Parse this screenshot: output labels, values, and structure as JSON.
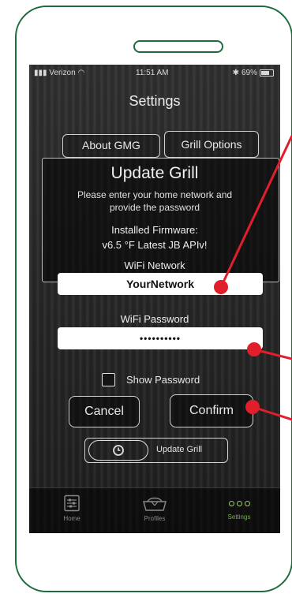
{
  "statusbar": {
    "carrier": "Verizon",
    "time": "11:51 AM",
    "battery": "69%"
  },
  "screen_title": "Settings",
  "tabs": {
    "about": "About GMG",
    "grill_options": "Grill Options"
  },
  "modal": {
    "title": "Update Grill",
    "instructions_line1": "Please enter your home network and",
    "instructions_line2": "provide the password",
    "firmware_label": "Installed Firmware:",
    "firmware_value": "v6.5 °F Latest JB APIv!",
    "network_label": "WiFi Network",
    "network_value": "YourNetwork",
    "password_label": "WiFi Password",
    "password_value": "••••••••••",
    "show_password_label": "Show Password",
    "cancel_label": "Cancel",
    "confirm_label": "Confirm"
  },
  "update_button": {
    "label": "Update Grill"
  },
  "tabbar": {
    "home": "Home",
    "profiles": "Profiles",
    "settings": "Settings"
  },
  "colors": {
    "frame": "#1f6b3e",
    "annotation": "#e11f2b",
    "active_tab": "#6fb340"
  }
}
